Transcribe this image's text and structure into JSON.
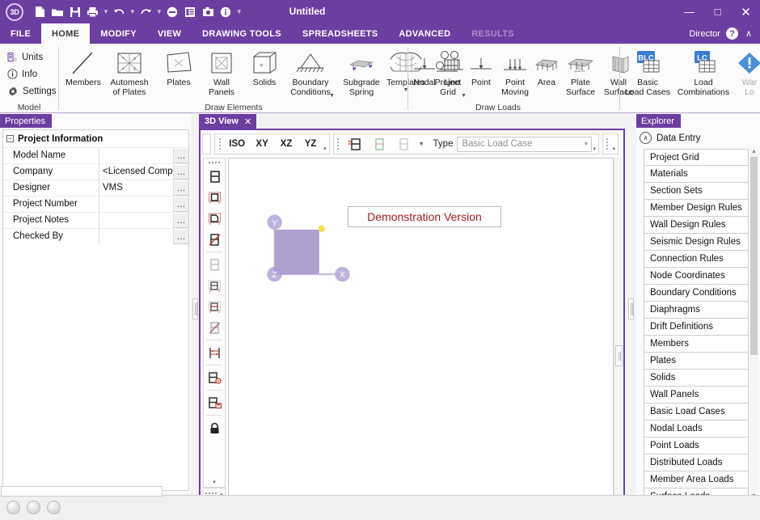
{
  "titlebar": {
    "logo": "3D",
    "title": "Untitled",
    "quick_access": [
      {
        "name": "new-file-icon"
      },
      {
        "name": "open-folder-icon"
      },
      {
        "name": "save-icon"
      },
      {
        "name": "print-icon"
      },
      {
        "name": "undo-icon"
      },
      {
        "name": "redo-icon"
      },
      {
        "name": "remove-icon"
      },
      {
        "name": "list-icon"
      },
      {
        "name": "camera-icon"
      },
      {
        "name": "info-icon"
      },
      {
        "name": "qat-overflow-icon"
      }
    ],
    "minimize": "—",
    "maximize": "□",
    "close": "✕"
  },
  "menu": {
    "tabs": [
      {
        "label": "FILE",
        "active": false,
        "disabled": false
      },
      {
        "label": "HOME",
        "active": true,
        "disabled": false
      },
      {
        "label": "MODIFY",
        "active": false,
        "disabled": false
      },
      {
        "label": "VIEW",
        "active": false,
        "disabled": false
      },
      {
        "label": "DRAWING TOOLS",
        "active": false,
        "disabled": false
      },
      {
        "label": "SPREADSHEETS",
        "active": false,
        "disabled": false
      },
      {
        "label": "ADVANCED",
        "active": false,
        "disabled": false
      },
      {
        "label": "RESULTS",
        "active": false,
        "disabled": true
      }
    ],
    "director": "Director",
    "help": "?",
    "collapse": "∧"
  },
  "ribbon": {
    "groups": [
      {
        "label": "Model"
      },
      {
        "label": "Draw Elements"
      },
      {
        "label": "Draw Loads"
      },
      {
        "label": ""
      }
    ],
    "model_items": [
      {
        "label": "Units",
        "icon": "units-icon"
      },
      {
        "label": "Info",
        "icon": "info-circle-icon"
      },
      {
        "label": "Settings",
        "icon": "gear-icon"
      }
    ],
    "draw_elements": [
      {
        "label": "Members",
        "icon": "member-line-icon",
        "dropdown": false
      },
      {
        "label": "Automesh\nof Plates",
        "icon": "automesh-icon",
        "dropdown": false
      },
      {
        "label": "Plates",
        "icon": "plate-icon",
        "dropdown": false
      },
      {
        "label": "Wall\nPanels",
        "icon": "wall-panel-icon",
        "dropdown": false
      },
      {
        "label": "Solids",
        "icon": "solid-cube-icon",
        "dropdown": false
      },
      {
        "label": "Boundary\nConditions",
        "icon": "boundary-condition-icon",
        "dropdown": true
      },
      {
        "label": "Subgrade\nSpring",
        "icon": "subgrade-spring-icon",
        "dropdown": false
      },
      {
        "label": "Templates",
        "icon": "templates-dome-icon",
        "dropdown": true
      },
      {
        "label": "Project\nGrid",
        "icon": "project-grid-icon",
        "dropdown": true
      }
    ],
    "draw_loads": [
      {
        "label": "Nodal",
        "icon": "nodal-load-icon"
      },
      {
        "label": "Line",
        "icon": "line-load-icon"
      },
      {
        "label": "Point",
        "icon": "point-load-icon"
      },
      {
        "label": "Point\nMoving",
        "icon": "point-moving-load-icon"
      },
      {
        "label": "Area",
        "icon": "area-load-icon"
      },
      {
        "label": "Plate\nSurface",
        "icon": "plate-surface-load-icon"
      },
      {
        "label": "Wall\nSurface",
        "icon": "wall-surface-load-icon"
      }
    ],
    "load_group": [
      {
        "label": "Basic\nLoad Cases",
        "icon": "blc-icon",
        "badge": "BLC",
        "dim": false
      },
      {
        "label": "Load\nCombinations",
        "icon": "lc-icon",
        "badge": "LC",
        "dim": false
      },
      {
        "label": "War\nLo",
        "icon": "warning-diamond-icon",
        "badge": "",
        "dim": true
      }
    ]
  },
  "properties": {
    "panel_title": "Properties",
    "section_title": "Project Information",
    "rows": [
      {
        "name": "Model Name",
        "value": ""
      },
      {
        "name": "Company",
        "value": "<Licensed Compan"
      },
      {
        "name": "Designer",
        "value": "VMS"
      },
      {
        "name": "Project Number",
        "value": ""
      },
      {
        "name": "Project Notes",
        "value": ""
      },
      {
        "name": "Checked By",
        "value": ""
      }
    ],
    "ellipsis": "…"
  },
  "document": {
    "tab_label": "3D View",
    "tab_close": "✕",
    "view_buttons": [
      "ISO",
      "XY",
      "XZ",
      "YZ"
    ],
    "type_label": "Type",
    "type_value": "Basic Load Case",
    "overflow": "▾",
    "render_toggles": [
      {
        "name": "show-loads-icon",
        "state": "active"
      },
      {
        "name": "show-loads-light-icon",
        "state": "normal"
      },
      {
        "name": "hide-loads-icon",
        "state": "dim"
      }
    ],
    "demo_banner": "Demonstration Version",
    "axes": {
      "x": "X",
      "y": "Y",
      "z": "Z"
    },
    "left_tools": [
      {
        "name": "frame-plain-icon"
      },
      {
        "name": "frame-selected-icon"
      },
      {
        "name": "frame-partial-icon"
      },
      {
        "name": "frame-cut-icon"
      },
      {
        "name": "frame-dim-icon"
      },
      {
        "name": "frame-lines-icon"
      },
      {
        "name": "frame-hatched-icon"
      },
      {
        "name": "frame-diagonal-icon"
      },
      {
        "name": "measure-distance-icon"
      },
      {
        "name": "frame-settings-icon"
      },
      {
        "name": "frame-save-icon"
      },
      {
        "name": "lock-icon"
      }
    ]
  },
  "explorer": {
    "panel_title": "Explorer",
    "group_label": "Data Entry",
    "collapse_icon": "∧",
    "items": [
      "Project Grid",
      "Materials",
      "Section Sets",
      "Member Design Rules",
      "Wall Design Rules",
      "Seismic Design Rules",
      "Connection Rules",
      "Node Coordinates",
      "Boundary Conditions",
      "Diaphragms",
      "Drift Definitions",
      "Members",
      "Plates",
      "Solids",
      "Wall Panels",
      "Basic Load Cases",
      "Nodal Loads",
      "Point Loads",
      "Distributed Loads",
      "Member Area Loads",
      "Surface Loads"
    ],
    "scroll_up": "▲",
    "scroll_down": "▼"
  },
  "statusbar": {
    "indicators": [
      "status-ball-1",
      "status-ball-2",
      "status-ball-3"
    ]
  },
  "colors": {
    "brand_purple": "#6b3fa0",
    "demo_red": "#9b1b1b",
    "plate_fill": "#b0a0d0",
    "node_yellow": "#f2e34a",
    "badge_blue": "#3a7bd5"
  }
}
